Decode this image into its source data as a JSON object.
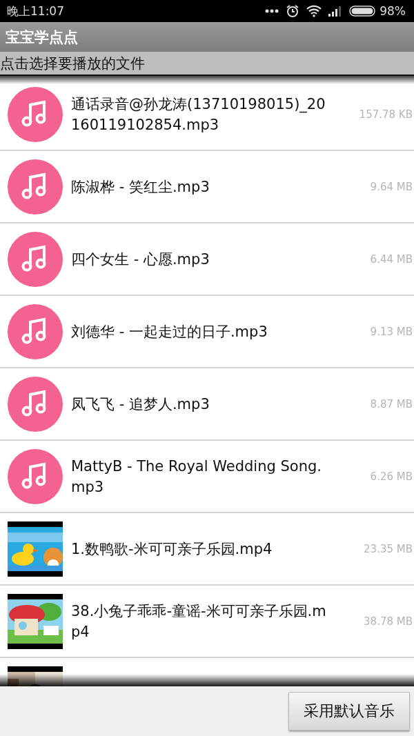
{
  "status_bar": {
    "time": "晚上11:07",
    "battery": "98%"
  },
  "app_bar": {
    "title": "宝宝学点点"
  },
  "subtitle": "点击选择要播放的文件",
  "files": [
    {
      "kind": "music",
      "name": "通话录音@孙龙涛(13710198015)_20160119102854.mp3",
      "size": "157.78 KB"
    },
    {
      "kind": "music",
      "name": "陈淑桦 - 笑红尘.mp3",
      "size": "9.64 MB"
    },
    {
      "kind": "music",
      "name": "四个女生 - 心愿.mp3",
      "size": "6.44 MB"
    },
    {
      "kind": "music",
      "name": "刘德华 - 一起走过的日子.mp3",
      "size": "9.13 MB"
    },
    {
      "kind": "music",
      "name": "凤飞飞 - 追梦人.mp3",
      "size": "8.87 MB"
    },
    {
      "kind": "music",
      "name": "MattyB - The Royal Wedding Song.mp3",
      "size": "6.26 MB"
    },
    {
      "kind": "video",
      "name": "1.数鸭歌-米可可亲子乐园.mp4",
      "size": "23.35 MB"
    },
    {
      "kind": "video",
      "name": "38.小兔子乖乖-童谣-米可可亲子乐园.mp4",
      "size": "38.78 MB"
    },
    {
      "kind": "video"
    }
  ],
  "buttons": [
    {
      "label": "采用默认音乐"
    }
  ]
}
